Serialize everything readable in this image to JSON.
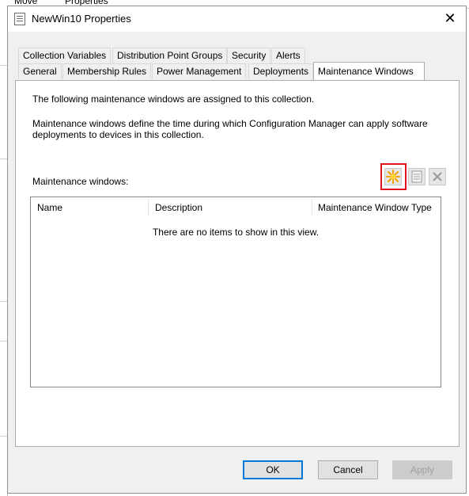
{
  "background": {
    "top_tabs": [
      "Move",
      "Properties"
    ]
  },
  "dialog": {
    "title": "NewWin10 Properties",
    "close_glyph": "✕",
    "tabs_row1": [
      "Collection Variables",
      "Distribution Point Groups",
      "Security",
      "Alerts"
    ],
    "tabs_row2": [
      "General",
      "Membership Rules",
      "Power Management",
      "Deployments",
      "Maintenance Windows"
    ],
    "active_tab": "Maintenance Windows",
    "intro_text": "The following maintenance windows are assigned to this collection.",
    "description_line1": "Maintenance windows define the time during which Configuration Manager can apply software",
    "description_line2": "deployments to devices in this collection.",
    "list_label": "Maintenance windows:",
    "columns": [
      "Name",
      "Description",
      "Maintenance Window Type"
    ],
    "empty_message": "There are no items to show in this view.",
    "toolbar": {
      "new_icon": "new-starburst-icon",
      "properties_icon": "properties-icon",
      "delete_icon": "delete-x-icon",
      "highlight_color": "#e0141c"
    },
    "buttons": {
      "ok": "OK",
      "cancel": "Cancel",
      "apply": "Apply"
    }
  }
}
